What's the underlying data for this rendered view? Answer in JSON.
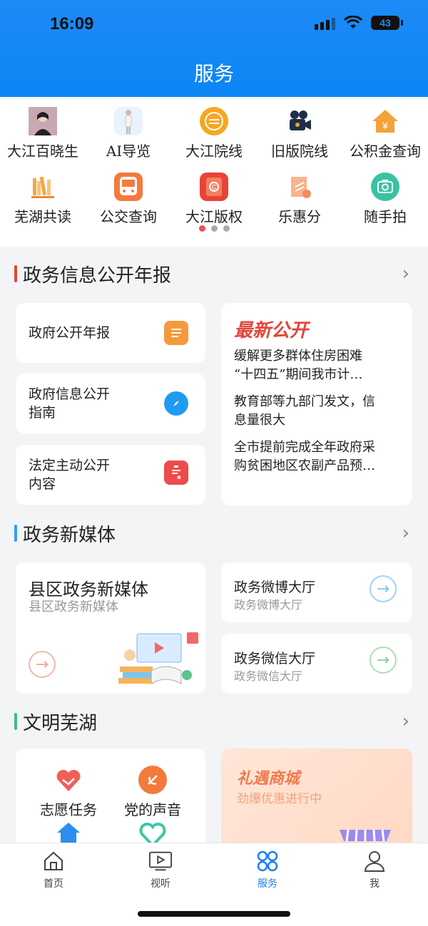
{
  "status": {
    "time": "16:09",
    "battery": "43"
  },
  "header": {
    "title": "服务"
  },
  "grid": {
    "items": [
      {
        "label": "大江百晓生",
        "icon": "avatar-icon"
      },
      {
        "label": "AI导览",
        "icon": "guide-figure-icon"
      },
      {
        "label": "大江院线",
        "icon": "film-reel-icon"
      },
      {
        "label": "旧版院线",
        "icon": "camera-icon"
      },
      {
        "label": "公积金查询",
        "icon": "house-yen-icon"
      },
      {
        "label": "芜湖共读",
        "icon": "bookshelf-icon"
      },
      {
        "label": "公交查询",
        "icon": "bus-icon"
      },
      {
        "label": "大江版权",
        "icon": "copyright-icon"
      },
      {
        "label": "乐惠分",
        "icon": "coupon-icon"
      },
      {
        "label": "随手拍",
        "icon": "snap-camera-icon"
      }
    ],
    "pages": 3,
    "active_page": 1
  },
  "section_gov": {
    "title": "政务信息公开年报",
    "cards": [
      {
        "label": "政府公开年报",
        "icon": "document-icon"
      },
      {
        "label_line1": "政府信息公开",
        "label_line2": "指南",
        "icon": "compass-icon"
      },
      {
        "label_line1": "法定主动公开",
        "label_line2": "内容",
        "icon": "clipboard-star-icon"
      }
    ],
    "news": {
      "title": "最新公开",
      "items": [
        {
          "line1": "缓解更多群体住房困难",
          "line2": "“十四五”期间我市计…"
        },
        {
          "line1": "教育部等九部门发文，信",
          "line2": "息量很大"
        },
        {
          "line1": "全市提前完成全年政府采",
          "line2": "购贫困地区农副产品预…"
        }
      ]
    }
  },
  "section_media": {
    "title": "政务新媒体",
    "big": {
      "title": "县区政务新媒体",
      "subtitle": "县区政务新媒体"
    },
    "weibo": {
      "title": "政务微博大厅",
      "subtitle": "政务微博大厅"
    },
    "wechat": {
      "title": "政务微信大厅",
      "subtitle": "政务微信大厅"
    }
  },
  "section_civ": {
    "title": "文明芜湖",
    "items": [
      {
        "label": "志愿任务",
        "icon": "heart-hands-icon"
      },
      {
        "label": "党的声音",
        "icon": "party-emblem-icon"
      }
    ],
    "mall": {
      "title": "礼遇商城",
      "subtitle": "劲爆优惠进行中"
    }
  },
  "tabbar": {
    "tabs": [
      {
        "label": "首页",
        "icon": "home-icon"
      },
      {
        "label": "视听",
        "icon": "tv-play-icon"
      },
      {
        "label": "服务",
        "icon": "grid-service-icon",
        "active": true
      },
      {
        "label": "我",
        "icon": "user-icon"
      }
    ]
  },
  "colors": {
    "primary": "#1e8af6",
    "accent_red": "#e2453c",
    "tab_active": "#1e7ff0"
  }
}
